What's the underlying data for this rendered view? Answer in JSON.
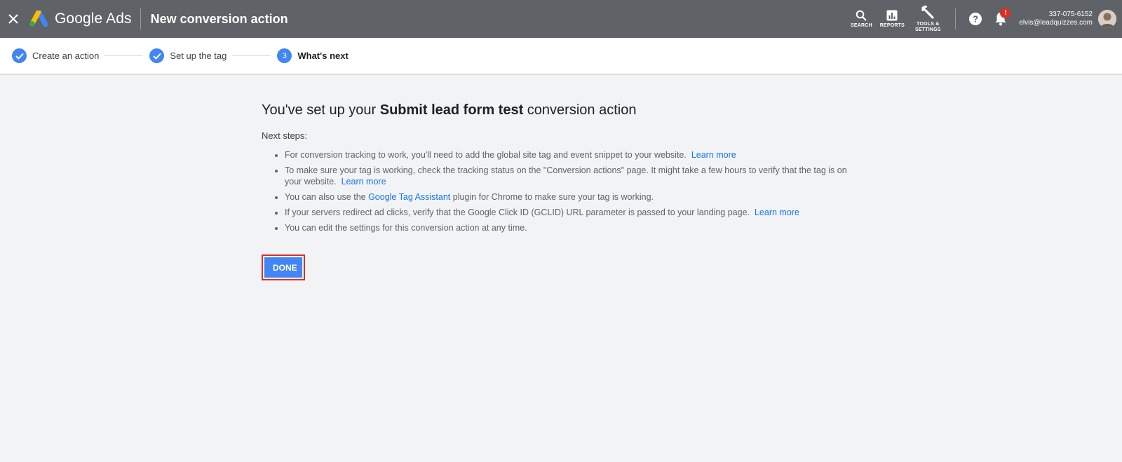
{
  "topbar": {
    "brand": "Google Ads",
    "title": "New conversion action",
    "tools": [
      {
        "label": "SEARCH"
      },
      {
        "label": "REPORTS"
      },
      {
        "label_line1": "TOOLS &",
        "label_line2": "SETTINGS"
      }
    ],
    "notification_badge": "!",
    "account_phone": "337-075-6152",
    "account_email": "elvis@leadquizzes.com"
  },
  "stepper": {
    "steps": [
      {
        "label": "Create an action",
        "status": "done"
      },
      {
        "label": "Set up the tag",
        "status": "done"
      },
      {
        "label": "What's next",
        "status": "current",
        "number": "3"
      }
    ]
  },
  "main": {
    "headline_prefix": "You've set up your ",
    "headline_bold": "Submit lead form test",
    "headline_suffix": " conversion action",
    "next_steps_label": "Next steps:",
    "items": [
      {
        "text": "For conversion tracking to work, you'll need to add the global site tag and event snippet to your website.",
        "link": "Learn more"
      },
      {
        "text": "To make sure your tag is working, check the tracking status on the \"Conversion actions\" page. It might take a few hours to verify that the tag is on your website.",
        "link": "Learn more"
      },
      {
        "text_before": "You can also use the ",
        "link": "Google Tag Assistant",
        "text_after": " plugin for Chrome to make sure your tag is working."
      },
      {
        "text": "If your servers redirect ad clicks, verify that the Google Click ID (GCLID) URL parameter is passed to your landing page.",
        "link": "Learn more"
      },
      {
        "text": "You can edit the settings for this conversion action at any time."
      }
    ],
    "done_label": "DONE"
  },
  "colors": {
    "topbar": "#5f6368",
    "accent": "#4285f4",
    "link": "#1a73e8",
    "highlight": "#d93025"
  }
}
